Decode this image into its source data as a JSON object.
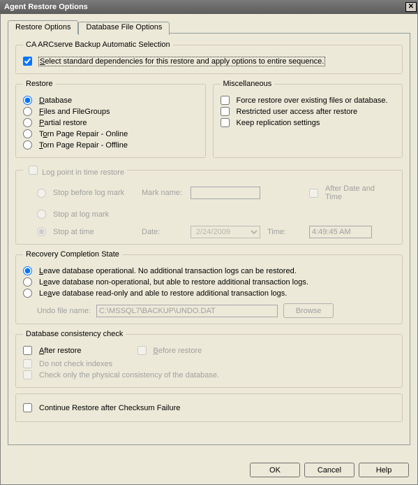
{
  "window": {
    "title": "Agent Restore Options"
  },
  "tabs": {
    "restore": "Restore Options",
    "dbfile": "Database File Options"
  },
  "autosel": {
    "legend": "CA ARCserve Backup Automatic Selection",
    "checkbox": "Select standard dependencies for this restore and apply options to entire sequence."
  },
  "restore": {
    "legend": "Restore",
    "database": "Database",
    "filesGroups": "Files and FileGroups",
    "partial": "Partial restore",
    "tornOnline": "Torn Page Repair - Online",
    "tornOffline": "Torn Page Repair - Offline"
  },
  "misc": {
    "legend": "Miscellaneous",
    "force": "Force restore over existing files or database.",
    "restricted": "Restricted user access after restore",
    "keeprepl": "Keep replication settings"
  },
  "logpoint": {
    "enable": "Log point in time restore",
    "stopBefore": "Stop before log mark",
    "stopAt": "Stop at log mark",
    "stopTime": "Stop at time",
    "markName": "Mark name:",
    "afterDT": "After Date and Time",
    "date": "Date:",
    "dateVal": "2/24/2009",
    "time": "Time:",
    "timeVal": "4:49:45 AM"
  },
  "recovery": {
    "legend": "Recovery Completion State",
    "opt1": "Leave database operational. No additional transaction logs can be restored.",
    "opt2": "Leave database non-operational, but able to restore additional transaction logs.",
    "opt3": "Leave database read-only and able to restore additional transaction logs.",
    "undoLabel": "Undo file name:",
    "undoVal": "C:\\MSSQL7\\BACKUP\\UNDO.DAT",
    "browse": "Browse"
  },
  "dbcc": {
    "legend": "Database consistency check",
    "after": "After restore",
    "before": "Before restore",
    "noIndex": "Do not check indexes",
    "physOnly": "Check only the physical consistency of the database."
  },
  "continue": {
    "label": "Continue Restore after Checksum Failure"
  },
  "buttons": {
    "ok": "OK",
    "cancel": "Cancel",
    "help": "Help"
  }
}
